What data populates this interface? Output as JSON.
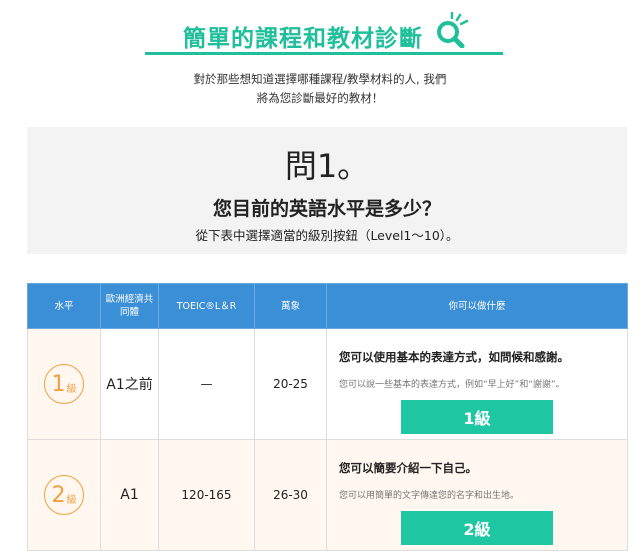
{
  "header": {
    "title": "簡單的課程和教材診斷"
  },
  "intro": {
    "line1": "對於那些想知道選擇哪種課程/教學材料的人, 我們",
    "line2": "將為您診斷最好的教材！"
  },
  "question": {
    "number": "問1。",
    "text": "您目前的英語水平是多少？",
    "instruction": "從下表中選擇適當的級別按鈕（Level1〜10）。"
  },
  "table": {
    "headers": [
      "水平",
      "歐洲經濟共\n同體",
      "TOEIC®L＆R",
      "萬象",
      "你可以做什麼"
    ],
    "rows": [
      {
        "badge_num": "1",
        "badge_unit": "級",
        "cefr": "A1之前",
        "toeic": "—",
        "eiken": "20-25",
        "desc_head": "您可以使用基本的表達方式，如問候和感謝。",
        "desc_sub": "您可以說一些基本的表達方式，例如“早上好”和“謝謝”。",
        "button": "1級"
      },
      {
        "badge_num": "2",
        "badge_unit": "級",
        "cefr": "A1",
        "toeic": "120-165",
        "eiken": "26-30",
        "desc_head": "您可以簡要介紹一下自己。",
        "desc_sub": "您可以用簡單的文字傳達您的名字和出生地。",
        "button": "2級"
      }
    ]
  },
  "colors": {
    "accent": "#1fbf9c",
    "header_blue": "#3b8fd6",
    "badge_orange": "#f0a040",
    "button_green": "#1ec7a1"
  }
}
